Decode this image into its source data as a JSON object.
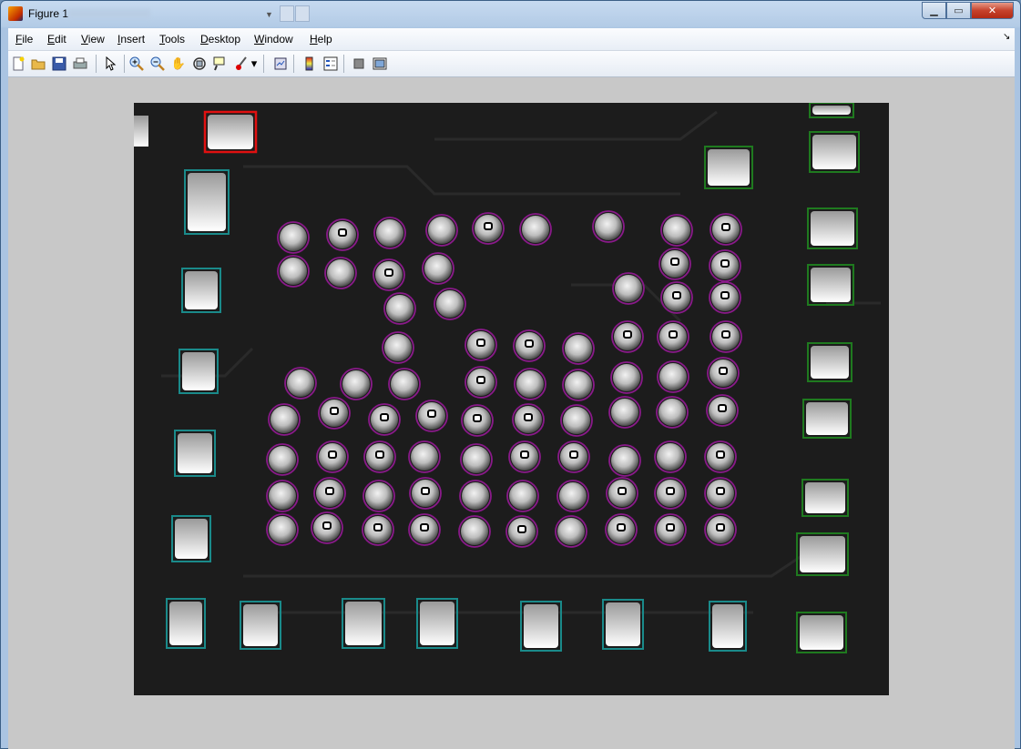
{
  "window": {
    "title": "Figure 1"
  },
  "menu": {
    "items": [
      {
        "key": "F",
        "rest": "ile"
      },
      {
        "key": "E",
        "rest": "dit"
      },
      {
        "key": "V",
        "rest": "iew"
      },
      {
        "key": "I",
        "rest": "nsert"
      },
      {
        "key": "T",
        "rest": "ools"
      },
      {
        "key": "D",
        "rest": "esktop"
      },
      {
        "key": "W",
        "rest": "indow"
      },
      {
        "key": "H",
        "rest": "elp"
      }
    ]
  },
  "toolbar": {
    "icons": [
      "new-figure-icon",
      "open-file-icon",
      "save-icon",
      "print-icon",
      "pointer-icon",
      "zoom-in-icon",
      "zoom-out-icon",
      "pan-hand-icon",
      "rotate-3d-icon",
      "data-cursor-icon",
      "brush-icon",
      "link-plot-icon",
      "colorbar-icon",
      "legend-icon",
      "hide-plot-tools-icon",
      "show-plot-tools-icon"
    ]
  },
  "image": {
    "description_free": true,
    "colors": {
      "background": "#1c1c1c",
      "pad_teal": "#1a8a8a",
      "pad_green": "#1f7a1f",
      "pad_red": "#e01010",
      "ball_outline": "#8a1a8a",
      "void_marker": "#000000"
    }
  }
}
